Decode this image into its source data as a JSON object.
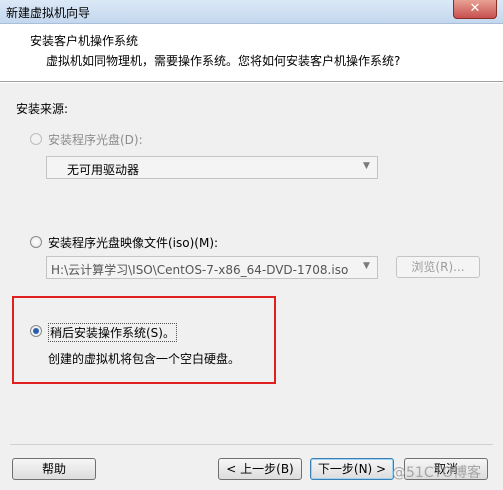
{
  "window": {
    "title": "新建虚拟机向导",
    "close_glyph": "✕"
  },
  "header": {
    "title": "安装客户机操作系统",
    "subtitle": "虚拟机如同物理机，需要操作系统。您将如何安装客户机操作系统?"
  },
  "source_label": "安装来源:",
  "options": {
    "disc": {
      "label": "安装程序光盘(D):",
      "selected": false,
      "enabled": false,
      "drive_value": "无可用驱动器"
    },
    "iso": {
      "label": "安装程序光盘映像文件(iso)(M):",
      "selected": false,
      "enabled": true,
      "path_value": "H:\\云计算学习\\ISO\\CentOS-7-x86_64-DVD-1708.iso",
      "browse_label": "浏览(R)..."
    },
    "later": {
      "label": "稍后安装操作系统(S)。",
      "selected": true,
      "description": "创建的虚拟机将包含一个空白硬盘。"
    }
  },
  "buttons": {
    "help": "帮助",
    "back": "< 上一步(B)",
    "next": "下一步(N) >",
    "cancel": "取消"
  },
  "watermark": "@51CTO博客",
  "colors": {
    "highlight": "#e01f1f",
    "radio_dot": "#2a5fb0"
  },
  "icons": {
    "dropdown": "chevron-down-icon"
  }
}
